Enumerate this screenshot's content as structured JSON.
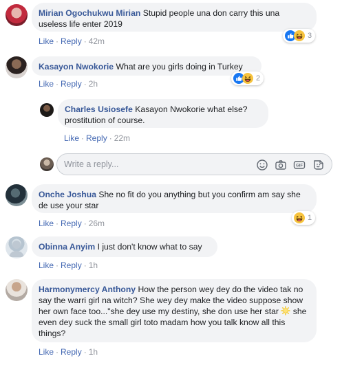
{
  "comments": [
    {
      "name": "Mirian Ogochukwu Mirian",
      "text": "Stupid people una don carry this una useless life enter 2019",
      "like": "Like",
      "reply": "Reply",
      "time": "42m",
      "reaction_count": "3",
      "reaction_icons": [
        "like-icon",
        "haha-icon"
      ]
    },
    {
      "name": "Kasayon Nwokorie",
      "text": "What are you girls doing in Turkey",
      "like": "Like",
      "reply": "Reply",
      "time": "2h",
      "reaction_count": "2",
      "reaction_icons": [
        "like-icon",
        "haha-icon"
      ]
    },
    {
      "name": "Charles Usiosefe",
      "text": "Kasayon Nwokorie what else? prostitution of course.",
      "like": "Like",
      "reply": "Reply",
      "time": "22m"
    },
    {
      "name": "Onche Joshua",
      "text": "She no fit do you anything but you confirm am say she de use your star",
      "like": "Like",
      "reply": "Reply",
      "time": "26m",
      "reaction_count": "1",
      "reaction_icons": [
        "haha-icon"
      ]
    },
    {
      "name": "Obinna Anyim",
      "text": "I just don't know what to say",
      "like": "Like",
      "reply": "Reply",
      "time": "1h"
    },
    {
      "name": "Harmonymercy Anthony",
      "text_before_emoji": "How the person wey dey do the video tak no say the warri girl na witch? She wey dey make the video suppose show her own face too...\"she dey use my destiny, she don use her star",
      "text_after_emoji": " she even dey suck the small girl toto madam how you talk know all this things?",
      "emoji": "sun-emoji",
      "like": "Like",
      "reply": "Reply",
      "time": "1h"
    }
  ],
  "reply_box": {
    "placeholder": "Write a reply...",
    "icons": [
      "emoji-icon",
      "camera-icon",
      "gif-icon",
      "sticker-icon"
    ]
  },
  "colors": {
    "name": "#385898",
    "link": "#4267b2",
    "meta": "#90949c",
    "bubble": "#f2f3f5",
    "like_blue": "#1877f2",
    "haha_yellow": "#f7c33e"
  }
}
